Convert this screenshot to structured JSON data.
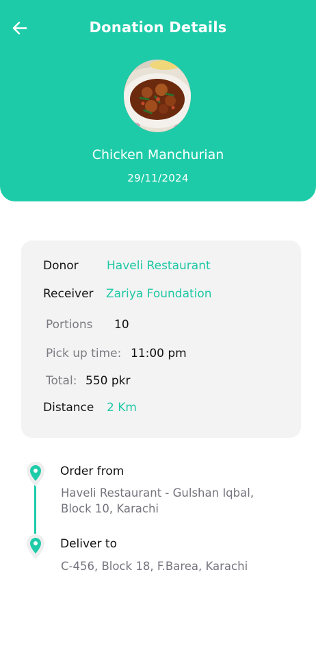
{
  "header": {
    "title": "Donation Details",
    "food_name": "Chicken Manchurian",
    "date": "29/11/2024"
  },
  "details": {
    "donor_label": "Donor",
    "donor_value": "Haveli Restaurant",
    "receiver_label": "Receiver",
    "receiver_value": "Zariya Foundation",
    "portions_label": "Portions",
    "portions_value": "10",
    "pickup_label": "Pick up time:",
    "pickup_value": "11:00 pm",
    "total_label": "Total:",
    "total_value": "550 pkr",
    "distance_label": "Distance",
    "distance_value": "2 Km"
  },
  "route": {
    "from_title": "Order from",
    "from_address_line1": "Haveli Restaurant - Gulshan Iqbal,",
    "from_address_line2": "Block 10, Karachi",
    "to_title": "Deliver to",
    "to_address": "C-456, Block 18, F.Barea, Karachi"
  },
  "colors": {
    "accent": "#1ecba8",
    "card_bg": "#f3f3f3",
    "muted_text": "#7c7c84"
  },
  "icons": {
    "back": "arrow-left-icon",
    "pin": "location-pin-icon"
  }
}
